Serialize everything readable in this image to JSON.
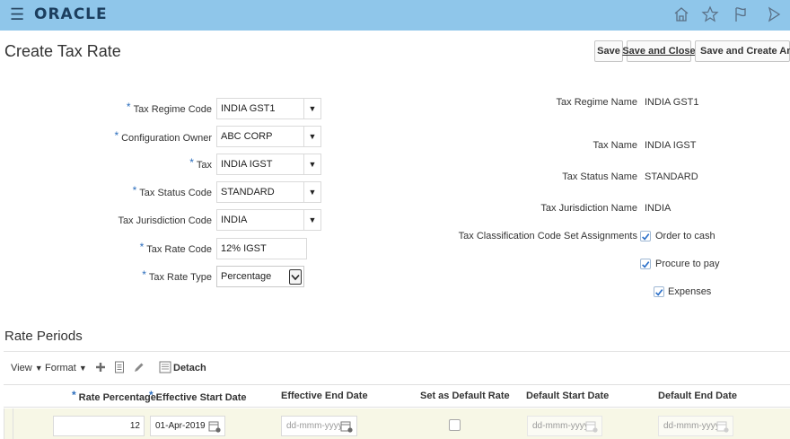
{
  "header": {
    "menu_icon": "hamburger-icon",
    "logo": "ORACLE",
    "icons": [
      "home-icon",
      "star-icon",
      "flag-icon",
      "notification-icon"
    ]
  },
  "page": {
    "title": "Create Tax Rate",
    "buttons": {
      "save": "Save",
      "save_close": "Save and Close",
      "save_create": "Save and Create Another"
    }
  },
  "form_left": {
    "tax_regime_code": {
      "label": "Tax Regime Code",
      "value": "INDIA GST1",
      "required": "*"
    },
    "configuration_owner": {
      "label": "Configuration Owner",
      "value": "ABC CORP",
      "required": "*"
    },
    "tax": {
      "label": "Tax",
      "value": "INDIA IGST",
      "required": "*"
    },
    "tax_status_code": {
      "label": "Tax Status Code",
      "value": "STANDARD",
      "required": "*"
    },
    "tax_jurisdiction_code": {
      "label": "Tax Jurisdiction Code",
      "value": "INDIA"
    },
    "tax_rate_code": {
      "label": "Tax Rate Code",
      "value": "12% IGST",
      "required": "*"
    },
    "tax_rate_type": {
      "label": "Tax Rate Type",
      "value": "Percentage",
      "required": "*"
    }
  },
  "form_right": {
    "tax_regime_name": {
      "label": "Tax Regime Name",
      "value": "INDIA GST1"
    },
    "tax_name": {
      "label": "Tax Name",
      "value": "INDIA IGST"
    },
    "tax_status_name": {
      "label": "Tax Status Name",
      "value": "STANDARD"
    },
    "tax_jurisdiction_name": {
      "label": "Tax Jurisdiction Name",
      "value": "INDIA"
    },
    "classification": {
      "label": "Tax Classification Code Set Assignments",
      "options": [
        {
          "label": "Order to cash",
          "checked": true
        },
        {
          "label": "Procure to pay",
          "checked": true
        },
        {
          "label": "Expenses",
          "checked": true
        }
      ]
    }
  },
  "rate_periods": {
    "title": "Rate Periods",
    "toolbar": {
      "view": "View",
      "format": "Format",
      "detach": "Detach",
      "icons": [
        "add-icon",
        "edit-document-icon",
        "pencil-icon",
        "detach-icon"
      ]
    },
    "columns": {
      "rate_percentage": "Rate Percentage",
      "effective_start": "Effective Start Date",
      "effective_end": "Effective End Date",
      "default_rate": "Set as Default Rate",
      "default_start": "Default Start Date",
      "default_end": "Default End Date",
      "required": "*"
    },
    "row": {
      "rate_percentage": "12",
      "effective_start": "01-Apr-2019",
      "effective_end_placeholder": "dd-mmm-yyyy",
      "default_rate_checked": false,
      "default_start_placeholder": "dd-mmm-yyyy",
      "default_end_placeholder": "dd-mmm-yyyy"
    }
  },
  "colors": {
    "topbar": "#8fc6ea",
    "required_marker": "#2c6ebd",
    "checkmark": "#2a6fc9",
    "grid_row": "#f7f7e6"
  }
}
